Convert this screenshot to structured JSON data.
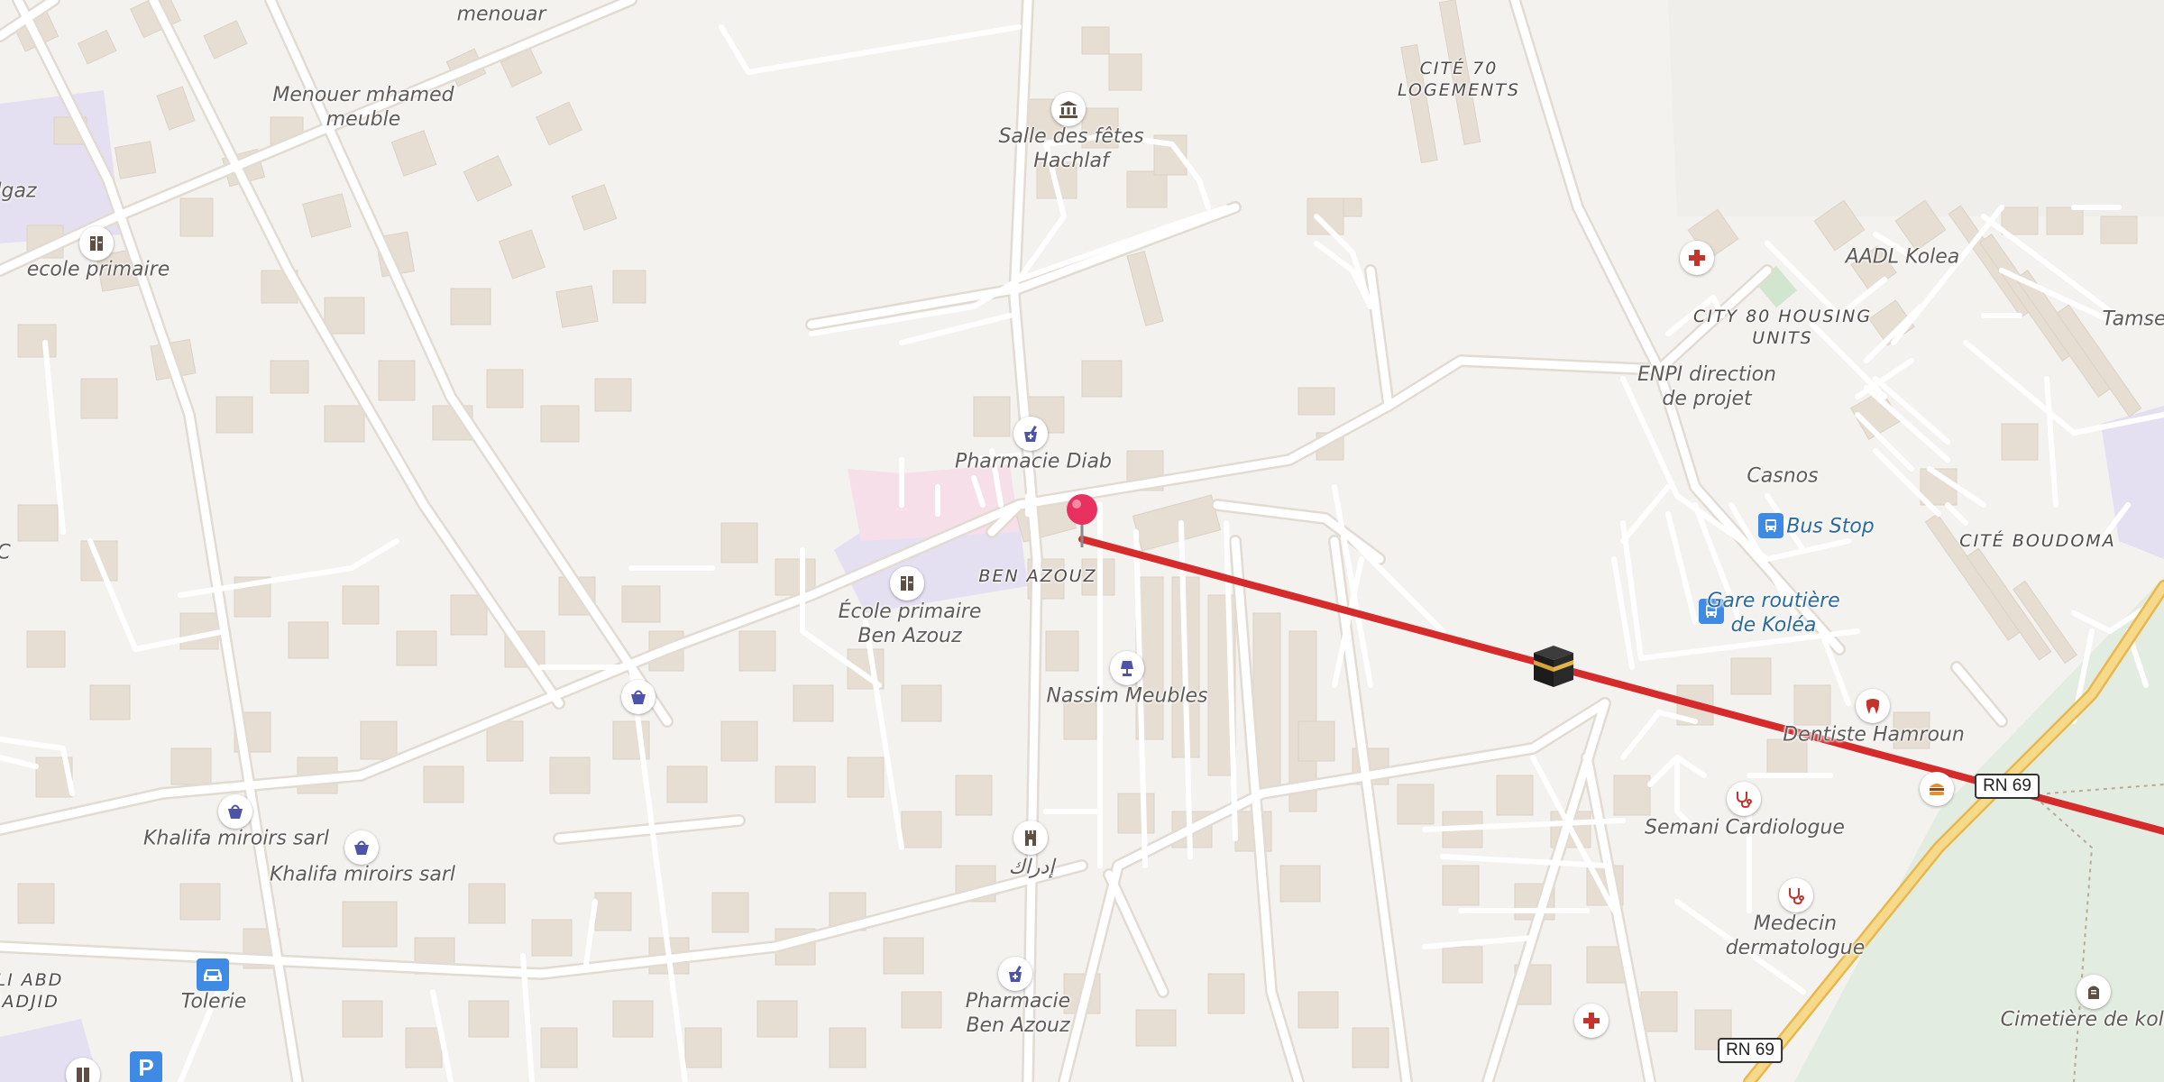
{
  "map": {
    "labels": {
      "menouar": "menouar",
      "menouer_mhamed_meuble": "Menouer mhamed\nmeuble",
      "salle_des_fetes": "Salle des fêtes\nHachlaf",
      "cite_70": "CITÉ 70\nLOGEMENTS",
      "algaz": "lgaz",
      "ecole_primaire": "ecole primaire",
      "aadl_kolea": "AADL Kolea",
      "city_80": "CITY 80 HOUSING\nUNITS",
      "tamse": "Tamse",
      "enpi": "ENPI direction\nde projet",
      "pharmacie_diab": "Pharmacie Diab",
      "casnos": "Casnos",
      "bus_stop": "Bus Stop",
      "cite_boudoma": "CITÉ BOUDOMA",
      "edge_c": "C",
      "ben_azouz": "BEN AZOUZ",
      "ecole_ben_azouz": "École primaire\nBen Azouz",
      "gare_routiere": "Gare routière\nde Koléa",
      "nassim_meubles": "Nassim Meubles",
      "dentiste_hamroun": "Dentiste Hamroun",
      "rn69_1": "RN 69",
      "semani_cardiologue": "Semani Cardiologue",
      "khalifa_1": "Khalifa miroirs sarl",
      "khalifa_2": "Khalifa miroirs sarl",
      "idrak": "إدراك",
      "medecin_dermatologue": "Medecin\ndermatologue",
      "ouli_abd_madjid": "ULI ABD\nMADJID",
      "tolerie": "Tolerie",
      "pharmacie_ben_azouz": "Pharmacie\nBen Azouz",
      "cimetiere": "Cimetière de kole",
      "rn69_2": "RN 69"
    },
    "icons": {
      "town_hall": "town-hall-icon",
      "school": "school-icon",
      "pharmacy": "pharmacy-icon",
      "hospital": "hospital-icon",
      "bus": "bus-icon",
      "shop": "shop-icon",
      "furniture": "lamp-icon",
      "dentist": "tooth-icon",
      "doctor": "stethoscope-icon",
      "fast_food": "burger-icon",
      "car_repair": "car-icon",
      "parking": "parking-icon",
      "cemetery": "grave-icon",
      "tower": "tower-icon",
      "pin": "map-pin-icon",
      "kaaba": "kaaba-icon"
    },
    "parking_letter": "P",
    "colors": {
      "background": "#f4f2ef",
      "building": "#e6ddd3",
      "road": "#ffffff",
      "route_line": "#d62b2b",
      "pin": "#e8315e",
      "highway": "#f3d27a",
      "school_area": "#e3dff2",
      "park": "#e2ece0"
    }
  }
}
